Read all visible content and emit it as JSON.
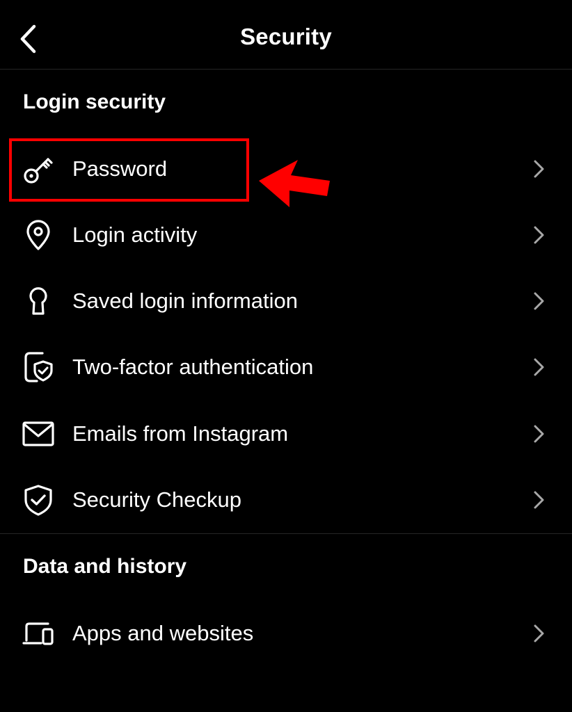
{
  "header": {
    "title": "Security",
    "back_icon": "chevron-left-icon"
  },
  "sections": [
    {
      "title": "Login security",
      "items": [
        {
          "label": "Password",
          "icon": "key-icon"
        },
        {
          "label": "Login activity",
          "icon": "location-pin-icon"
        },
        {
          "label": "Saved login information",
          "icon": "keyhole-icon"
        },
        {
          "label": "Two-factor authentication",
          "icon": "phone-shield-icon"
        },
        {
          "label": "Emails from Instagram",
          "icon": "envelope-icon"
        },
        {
          "label": "Security Checkup",
          "icon": "shield-check-icon"
        }
      ]
    },
    {
      "title": "Data and history",
      "items": [
        {
          "label": "Apps and websites",
          "icon": "devices-icon"
        }
      ]
    }
  ],
  "annotation": {
    "highlight_color": "#ff0000",
    "highlighted_item": "Password"
  },
  "colors": {
    "background": "#000000",
    "text": "#ffffff",
    "chevron": "#a8a8a8",
    "divider": "#262626"
  }
}
